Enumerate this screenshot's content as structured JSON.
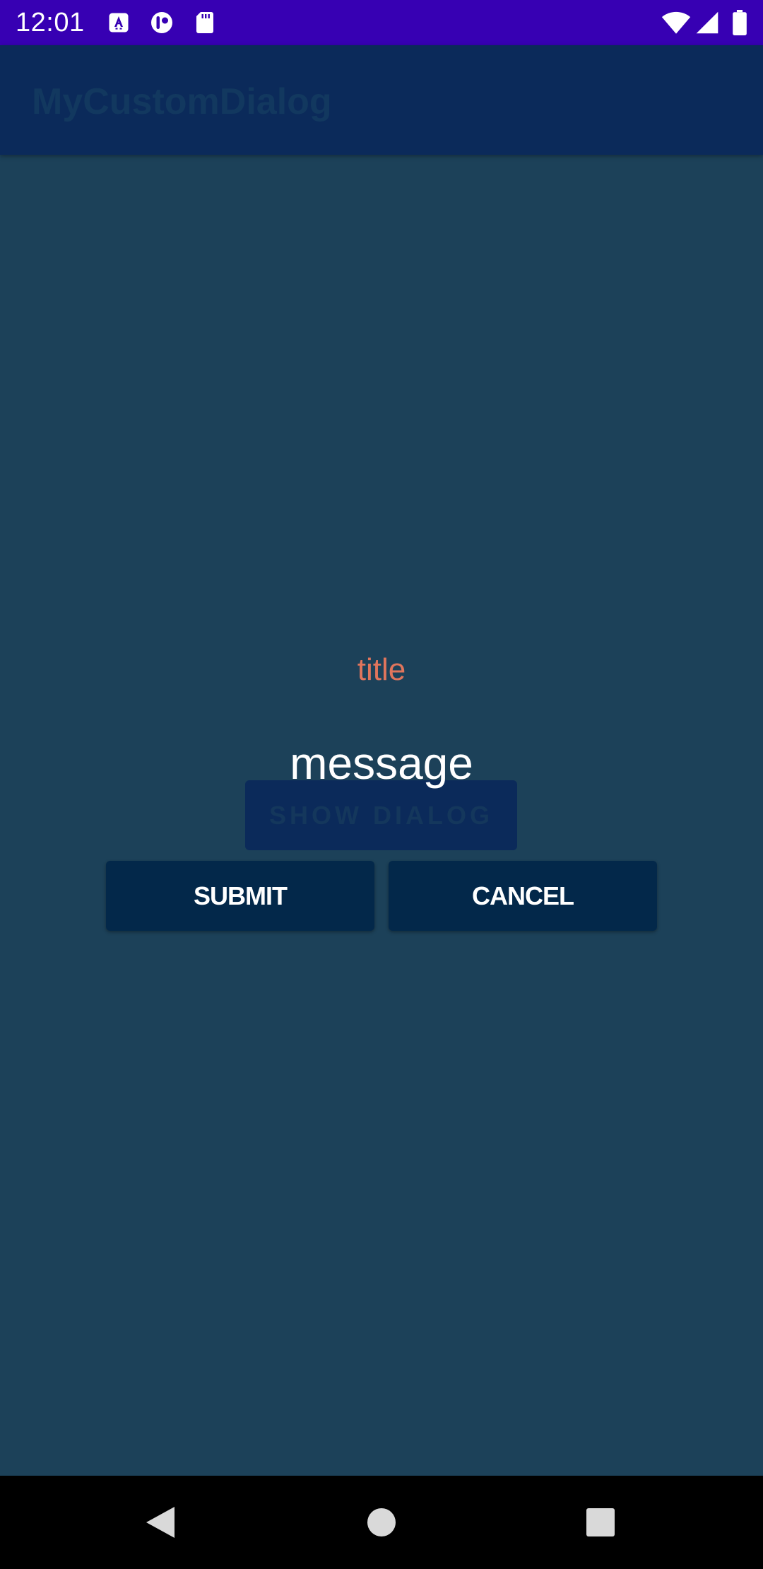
{
  "status_bar": {
    "time": "12:01",
    "notification_icons": [
      "a-translate-icon",
      "toggle-app-icon",
      "sd-card-icon"
    ],
    "system_icons": [
      "wifi-icon",
      "signal-icon",
      "battery-icon"
    ],
    "color": "#3700b3"
  },
  "app_bar": {
    "title": "MyCustomDialog"
  },
  "main": {
    "show_dialog_label": "SHOW DIALOG"
  },
  "dialog": {
    "title": "title",
    "message": "message",
    "submit_label": "SUBMIT",
    "cancel_label": "CANCEL",
    "title_color": "#e0755c"
  },
  "nav_bar": {
    "buttons": [
      "back-icon",
      "home-icon",
      "recents-icon"
    ]
  }
}
